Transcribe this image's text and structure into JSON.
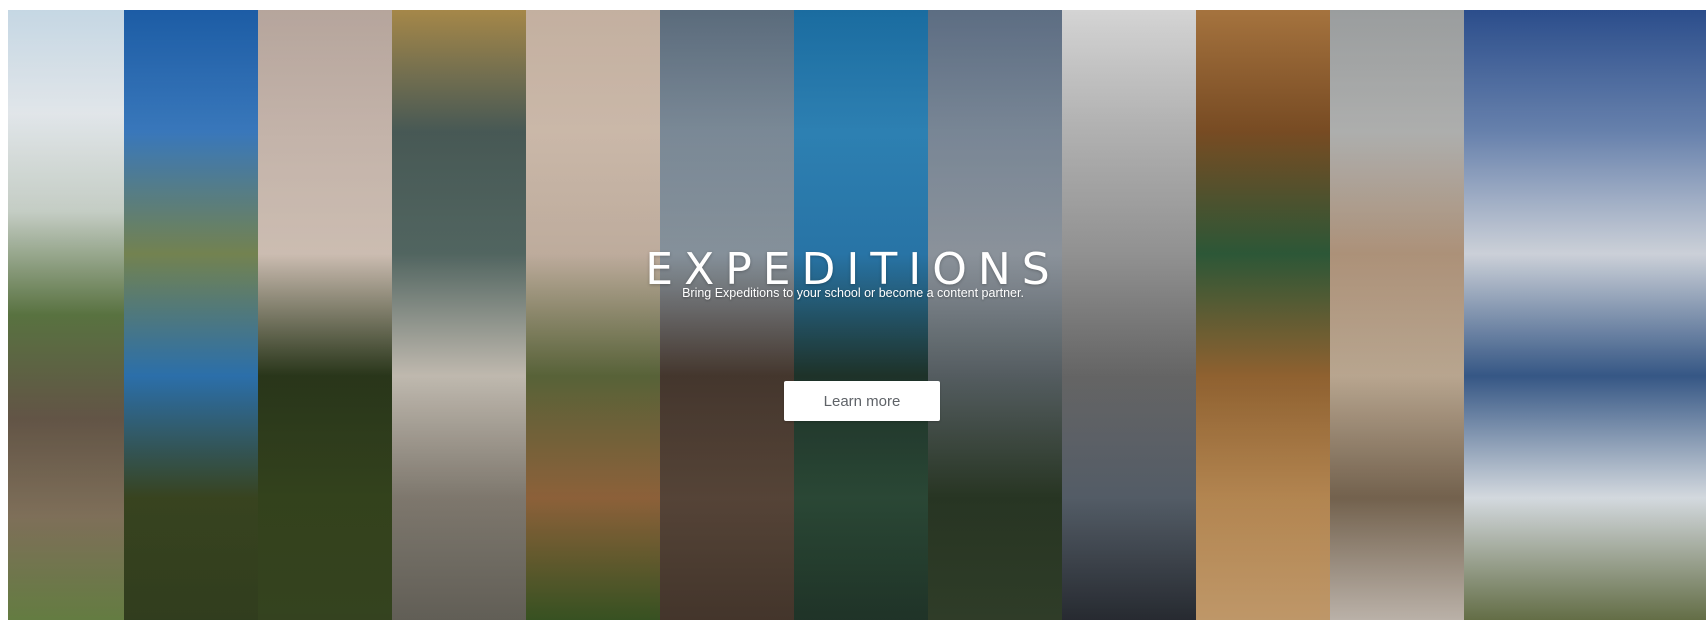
{
  "hero": {
    "title": "EXPEDITIONS",
    "subtitle": "Bring Expeditions to your school or become a content partner.",
    "cta_label": "Learn more",
    "photo_strips": [
      {
        "name": "photo-strip-ruins",
        "colors": [
          "#c9dbe8",
          "#e9eef2",
          "#cfd8cf",
          "#5f7a45",
          "#6b5c4c",
          "#8b7a62",
          "#6f8a49"
        ]
      },
      {
        "name": "photo-strip-lake",
        "colors": [
          "#1d5ea8",
          "#3b7cc2",
          "#7a8a55",
          "#2f78b8",
          "#3d4a22",
          "#364421"
        ]
      },
      {
        "name": "photo-strip-statue",
        "colors": [
          "#b9a89f",
          "#cbbab0",
          "#d8c8bc",
          "#2c3a1c",
          "#38481f",
          "#3a4a22"
        ]
      },
      {
        "name": "photo-strip-architecture",
        "colors": [
          "#a88a4a",
          "#4a5c58",
          "#566b66",
          "#cfc8bd",
          "#8a8378",
          "#6c6960"
        ]
      },
      {
        "name": "photo-strip-great-wall",
        "colors": [
          "#c7b3a3",
          "#d2bfaf",
          "#c9b6a6",
          "#5f6a3d",
          "#9a6a3f",
          "#3d5a25"
        ]
      },
      {
        "name": "photo-strip-rocky-sky",
        "colors": [
          "#5c6d7e",
          "#7f8e9c",
          "#8d99a3",
          "#4a3b31",
          "#5d4a3c",
          "#4b3b30"
        ]
      },
      {
        "name": "photo-strip-ocean-coral",
        "colors": [
          "#1b6ea3",
          "#2f85b9",
          "#2a7bb0",
          "#20362c",
          "#2e4e3a",
          "#23392c"
        ]
      },
      {
        "name": "photo-strip-mountains",
        "colors": [
          "#5e6f85",
          "#7d8b9b",
          "#939ba4",
          "#5b6468",
          "#2b3a26",
          "#34432c"
        ]
      },
      {
        "name": "photo-strip-ferris-wheel",
        "colors": [
          "#d8d8d8",
          "#b7b7b7",
          "#9a9a9a",
          "#6d6d6d",
          "#5b6570",
          "#2b2f36"
        ]
      },
      {
        "name": "photo-strip-museum-hall",
        "colors": [
          "#a8753f",
          "#7c4e24",
          "#2f5c3a",
          "#9b6934",
          "#c49258",
          "#d4a874"
        ]
      },
      {
        "name": "photo-strip-bridge",
        "colors": [
          "#9da0a1",
          "#b4b5b4",
          "#b79a80",
          "#c7b39b",
          "#7e6b55",
          "#cfc5bb"
        ]
      },
      {
        "name": "photo-strip-seashore",
        "colors": [
          "#2c4f8e",
          "#6b86b3",
          "#d8dde5",
          "#3a5e90",
          "#e8eef4",
          "#6f7a4e"
        ]
      }
    ]
  }
}
